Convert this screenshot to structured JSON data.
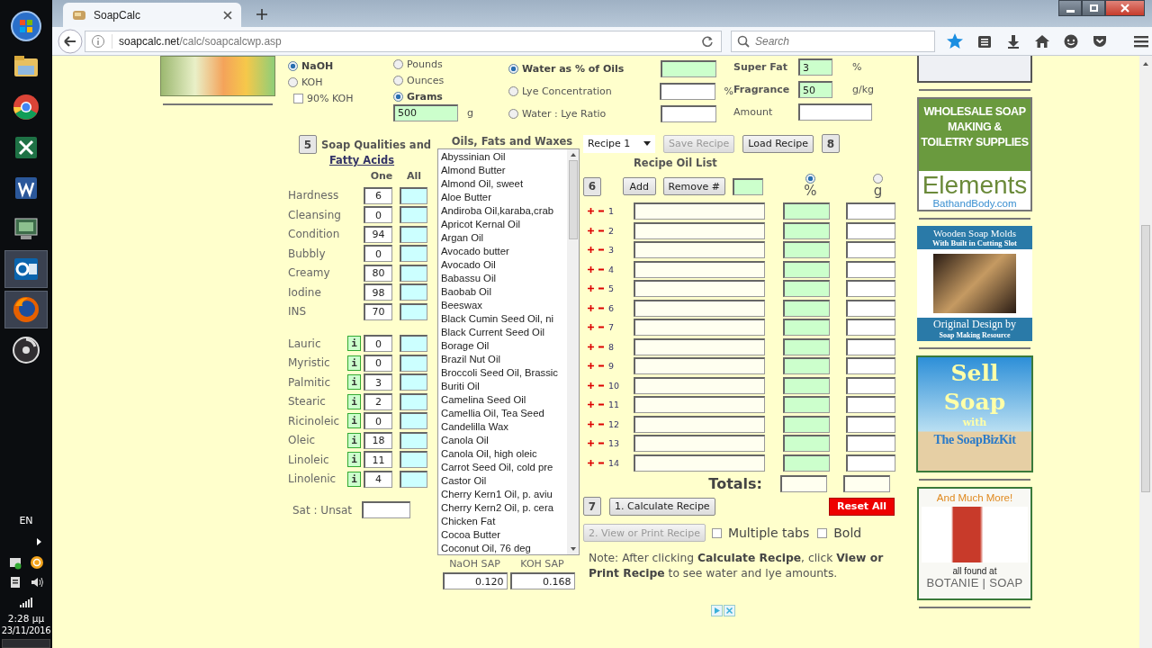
{
  "taskbar": {
    "language": "EN",
    "time": "2:28 μμ",
    "date": "23/11/2016"
  },
  "browser": {
    "tabs": [
      {
        "title": "SoapCalc",
        "selected": true
      }
    ],
    "url_host": "soapcalc.net",
    "url_path": "/calc/soapcalcwp.asp",
    "search": {
      "placeholder": "Search"
    }
  },
  "lye_type": [
    {
      "label": "NaOH",
      "selected": true
    },
    {
      "label": "KOH",
      "selected": false
    }
  ],
  "koh90": {
    "label": "90% KOH",
    "checked": false
  },
  "weight_units": [
    {
      "label": "Pounds",
      "selected": false
    },
    {
      "label": "Ounces",
      "selected": false
    },
    {
      "label": "Grams",
      "selected": true
    }
  ],
  "oil_weight": {
    "value": "500",
    "unit": "g"
  },
  "water_options": [
    {
      "label": "Water as % of Oils",
      "selected": true
    },
    {
      "label": "Lye Concentration",
      "selected": false,
      "unit": "%"
    },
    {
      "label": "Water : Lye Ratio",
      "selected": false
    }
  ],
  "super_fat": {
    "label": "Super Fat",
    "value": "3",
    "unit": "%"
  },
  "fragrance": {
    "label": "Fragrance",
    "value": "50",
    "unit": "g/kg"
  },
  "amount": {
    "label": "Amount"
  },
  "qualities": {
    "step": "5",
    "title": "Soap Qualities and",
    "link": "Fatty Acids",
    "col_one": "One",
    "col_all": "All",
    "rows": [
      {
        "label": "Hardness",
        "one": "6"
      },
      {
        "label": "Cleansing",
        "one": "0"
      },
      {
        "label": "Condition",
        "one": "94"
      },
      {
        "label": "Bubbly",
        "one": "0"
      },
      {
        "label": "Creamy",
        "one": "80"
      },
      {
        "label": "Iodine",
        "one": "98"
      },
      {
        "label": "INS",
        "one": "70"
      }
    ],
    "acids": [
      {
        "label": "Lauric",
        "info": "i",
        "one": "0"
      },
      {
        "label": "Myristic",
        "info": "i",
        "one": "0"
      },
      {
        "label": "Palmitic",
        "info": "i",
        "one": "3"
      },
      {
        "label": "Stearic",
        "info": "i",
        "one": "2"
      },
      {
        "label": "Ricinoleic",
        "info": "i",
        "one": "0"
      },
      {
        "label": "Oleic",
        "info": "i",
        "one": "18"
      },
      {
        "label": "Linoleic",
        "info": "i",
        "one": "11"
      },
      {
        "label": "Linolenic",
        "info": "i",
        "one": "4"
      }
    ],
    "ratio_label": "Sat : Unsat"
  },
  "oils": {
    "title": "Oils, Fats and Waxes",
    "items": [
      "Abyssinian Oil",
      "Almond Butter",
      "Almond Oil, sweet",
      "Aloe Butter",
      "Andiroba Oil,karaba,crab",
      "Apricot Kernal Oil",
      "Argan Oil",
      "Avocado butter",
      "Avocado Oil",
      "Babassu Oil",
      "Baobab Oil",
      "Beeswax",
      "Black Cumin Seed Oil, ni",
      "Black Current Seed Oil",
      "Borage Oil",
      "Brazil Nut Oil",
      "Broccoli Seed Oil, Brassic",
      "Buriti Oil",
      "Camelina Seed Oil",
      "Camellia Oil, Tea Seed",
      "Candelilla Wax",
      "Canola Oil",
      "Canola Oil, high oleic",
      "Carrot Seed Oil, cold pre",
      "Castor Oil",
      "Cherry Kern1 Oil, p. aviu",
      "Cherry Kern2 Oil, p. cera",
      "Chicken Fat",
      "Cocoa Butter",
      "Coconut Oil, 76 deg"
    ],
    "naoh_sap_label": "NaOH SAP",
    "koh_sap_label": "KOH SAP",
    "naoh_sap": "0.120",
    "koh_sap": "0.168"
  },
  "recipe": {
    "select": "Recipe 1",
    "buttons": [
      {
        "label": "Save Recipe",
        "disabled": true
      },
      {
        "label": "Load Recipe",
        "disabled": false
      }
    ],
    "step_load": "8",
    "title": "Recipe Oil List",
    "step_list": "6",
    "add": "Add",
    "remove": "Remove #",
    "modes": [
      {
        "label": "%",
        "selected": true
      },
      {
        "label": "g",
        "selected": false
      }
    ],
    "rows": [
      "1",
      "2",
      "3",
      "4",
      "5",
      "6",
      "7",
      "8",
      "9",
      "10",
      "11",
      "12",
      "13",
      "14"
    ],
    "totals_label": "Totals:",
    "step_calc": "7",
    "calculate": "1. Calculate Recipe",
    "reset": "Reset All",
    "view": {
      "label": "2. View or Print Recipe",
      "disabled": true
    },
    "options": [
      {
        "label": "Multiple tabs",
        "checked": false
      },
      {
        "label": "Bold",
        "checked": false
      }
    ],
    "note": "Note: After clicking **Calculate Recipe**, click **View or Print Recipe** to see water and lye amounts."
  },
  "ads": {
    "wholesale": {
      "headline": "WHOLESALE SOAP MAKING & TOILETRY SUPPLIES",
      "brand": "Elements",
      "site": "BathandBody.com"
    },
    "molds": {
      "headline": "Wooden Soap Molds",
      "subline": "With Built in Cutting Slot",
      "footer": "Original Design by",
      "footer_sub": "Soap Making Resource"
    },
    "bizkit": {
      "headline": "Sell Soap",
      "with": "with",
      "brand": "The SoapBizKit"
    },
    "botanie": {
      "headline": "And Much More!",
      "found": "all found at",
      "brand": "BOTANIE | SOAP"
    }
  }
}
